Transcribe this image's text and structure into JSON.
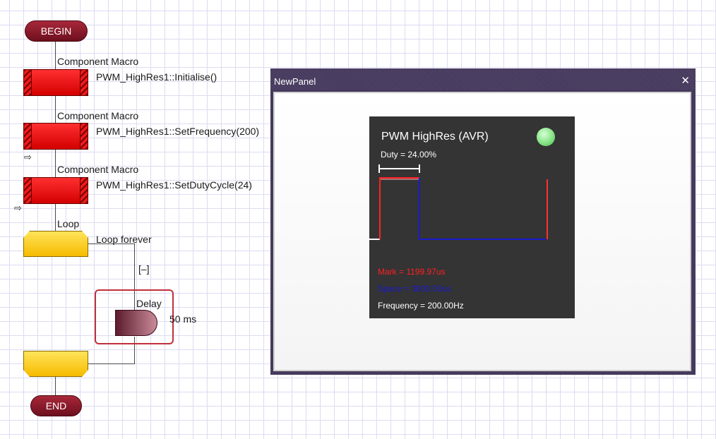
{
  "flowchart": {
    "begin_label": "BEGIN",
    "end_label": "END",
    "steps": [
      {
        "type_label": "Component Macro",
        "call": "PWM_HighRes1::Initialise()"
      },
      {
        "type_label": "Component Macro",
        "call": "PWM_HighRes1::SetFrequency(200)"
      },
      {
        "type_label": "Component Macro",
        "call": "PWM_HighRes1::SetDutyCycle(24)"
      }
    ],
    "loop": {
      "type_label": "Loop",
      "condition": "Loop forever",
      "collapse_label": "[–]"
    },
    "delay": {
      "type_label": "Delay",
      "value": "50 ms"
    },
    "colors": {
      "macro": "#e81010",
      "loop": "#fcd116",
      "terminator": "#8e1a2a",
      "delay": "#8a3a50"
    }
  },
  "panel": {
    "title": "NewPanel",
    "close_icon": "close-icon",
    "scope": {
      "title": "PWM HighRes (AVR)",
      "indicator": "green-led",
      "duty_label": "Duty = 24.00%",
      "mark_label": "Mark = 1199.97us",
      "space_label": "Space = 3800.03us",
      "frequency_label": "Frequency = 200.00Hz",
      "colors": {
        "mark": "#ff2020",
        "space": "#1a1ad0",
        "background": "#343434"
      }
    }
  }
}
